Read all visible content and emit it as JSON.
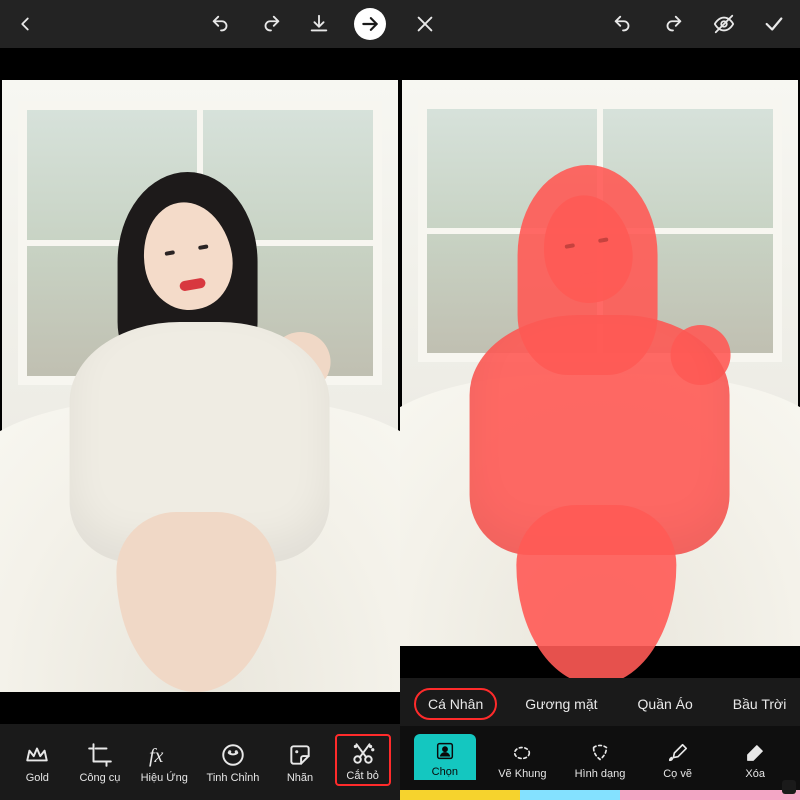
{
  "left": {
    "topbar_icons": [
      "back-icon",
      "undo-icon",
      "redo-icon",
      "download-icon",
      "next-icon"
    ],
    "tools": [
      {
        "id": "gold",
        "label": "Gold",
        "icon": "crown-icon",
        "highlighted": false
      },
      {
        "id": "tools",
        "label": "Công cụ",
        "icon": "crop-icon",
        "highlighted": false
      },
      {
        "id": "fx",
        "label": "Hiệu Ứng",
        "icon": "fx-icon",
        "highlighted": false
      },
      {
        "id": "adjust",
        "label": "Tinh Chỉnh",
        "icon": "adjust-icon",
        "highlighted": false
      },
      {
        "id": "sticker",
        "label": "Nhãn",
        "icon": "sticker-icon",
        "highlighted": false
      },
      {
        "id": "cutout",
        "label": "Cắt bỏ",
        "icon": "cutout-icon",
        "highlighted": true
      }
    ]
  },
  "right": {
    "topbar_icons": [
      "close-icon",
      "undo-icon",
      "redo-icon",
      "eye-crossed-icon",
      "confirm-icon"
    ],
    "chips": [
      {
        "id": "person",
        "label": "Cá Nhân",
        "highlighted": true
      },
      {
        "id": "face",
        "label": "Gương mặt",
        "highlighted": false
      },
      {
        "id": "clothes",
        "label": "Quần Áo",
        "highlighted": false
      },
      {
        "id": "sky",
        "label": "Bầu Trời",
        "highlighted": false
      }
    ],
    "selection_tools": [
      {
        "id": "select",
        "label": "Chọn",
        "icon": "select-person-icon",
        "active": true
      },
      {
        "id": "outline",
        "label": "Vẽ Khung",
        "icon": "outline-icon",
        "active": false
      },
      {
        "id": "shape",
        "label": "Hình dạng",
        "icon": "shape-icon",
        "active": false
      },
      {
        "id": "brush",
        "label": "Cọ vẽ",
        "icon": "brush-icon",
        "active": false
      },
      {
        "id": "erase",
        "label": "Xóa",
        "icon": "erase-icon",
        "active": false
      }
    ],
    "mask_color": "#ff5a55"
  }
}
